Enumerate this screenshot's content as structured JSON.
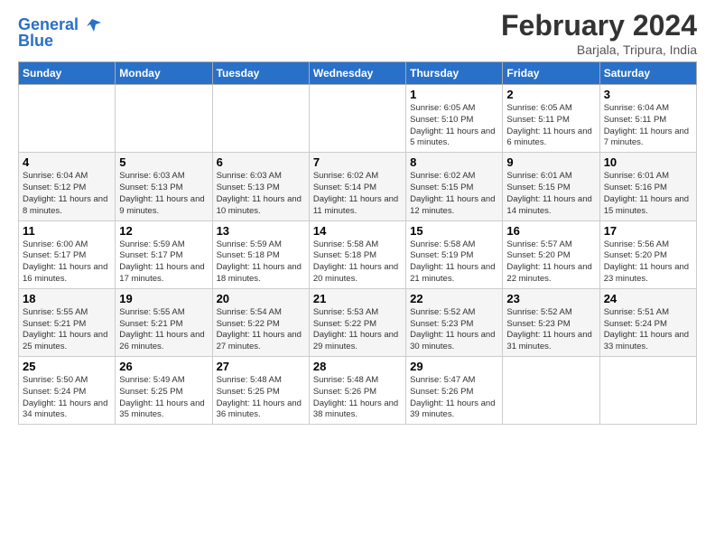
{
  "header": {
    "logo_line1": "General",
    "logo_line2": "Blue",
    "month_year": "February 2024",
    "location": "Barjala, Tripura, India"
  },
  "weekdays": [
    "Sunday",
    "Monday",
    "Tuesday",
    "Wednesday",
    "Thursday",
    "Friday",
    "Saturday"
  ],
  "weeks": [
    [
      {
        "day": "",
        "info": ""
      },
      {
        "day": "",
        "info": ""
      },
      {
        "day": "",
        "info": ""
      },
      {
        "day": "",
        "info": ""
      },
      {
        "day": "1",
        "info": "Sunrise: 6:05 AM\nSunset: 5:10 PM\nDaylight: 11 hours and 5 minutes."
      },
      {
        "day": "2",
        "info": "Sunrise: 6:05 AM\nSunset: 5:11 PM\nDaylight: 11 hours and 6 minutes."
      },
      {
        "day": "3",
        "info": "Sunrise: 6:04 AM\nSunset: 5:11 PM\nDaylight: 11 hours and 7 minutes."
      }
    ],
    [
      {
        "day": "4",
        "info": "Sunrise: 6:04 AM\nSunset: 5:12 PM\nDaylight: 11 hours and 8 minutes."
      },
      {
        "day": "5",
        "info": "Sunrise: 6:03 AM\nSunset: 5:13 PM\nDaylight: 11 hours and 9 minutes."
      },
      {
        "day": "6",
        "info": "Sunrise: 6:03 AM\nSunset: 5:13 PM\nDaylight: 11 hours and 10 minutes."
      },
      {
        "day": "7",
        "info": "Sunrise: 6:02 AM\nSunset: 5:14 PM\nDaylight: 11 hours and 11 minutes."
      },
      {
        "day": "8",
        "info": "Sunrise: 6:02 AM\nSunset: 5:15 PM\nDaylight: 11 hours and 12 minutes."
      },
      {
        "day": "9",
        "info": "Sunrise: 6:01 AM\nSunset: 5:15 PM\nDaylight: 11 hours and 14 minutes."
      },
      {
        "day": "10",
        "info": "Sunrise: 6:01 AM\nSunset: 5:16 PM\nDaylight: 11 hours and 15 minutes."
      }
    ],
    [
      {
        "day": "11",
        "info": "Sunrise: 6:00 AM\nSunset: 5:17 PM\nDaylight: 11 hours and 16 minutes."
      },
      {
        "day": "12",
        "info": "Sunrise: 5:59 AM\nSunset: 5:17 PM\nDaylight: 11 hours and 17 minutes."
      },
      {
        "day": "13",
        "info": "Sunrise: 5:59 AM\nSunset: 5:18 PM\nDaylight: 11 hours and 18 minutes."
      },
      {
        "day": "14",
        "info": "Sunrise: 5:58 AM\nSunset: 5:18 PM\nDaylight: 11 hours and 20 minutes."
      },
      {
        "day": "15",
        "info": "Sunrise: 5:58 AM\nSunset: 5:19 PM\nDaylight: 11 hours and 21 minutes."
      },
      {
        "day": "16",
        "info": "Sunrise: 5:57 AM\nSunset: 5:20 PM\nDaylight: 11 hours and 22 minutes."
      },
      {
        "day": "17",
        "info": "Sunrise: 5:56 AM\nSunset: 5:20 PM\nDaylight: 11 hours and 23 minutes."
      }
    ],
    [
      {
        "day": "18",
        "info": "Sunrise: 5:55 AM\nSunset: 5:21 PM\nDaylight: 11 hours and 25 minutes."
      },
      {
        "day": "19",
        "info": "Sunrise: 5:55 AM\nSunset: 5:21 PM\nDaylight: 11 hours and 26 minutes."
      },
      {
        "day": "20",
        "info": "Sunrise: 5:54 AM\nSunset: 5:22 PM\nDaylight: 11 hours and 27 minutes."
      },
      {
        "day": "21",
        "info": "Sunrise: 5:53 AM\nSunset: 5:22 PM\nDaylight: 11 hours and 29 minutes."
      },
      {
        "day": "22",
        "info": "Sunrise: 5:52 AM\nSunset: 5:23 PM\nDaylight: 11 hours and 30 minutes."
      },
      {
        "day": "23",
        "info": "Sunrise: 5:52 AM\nSunset: 5:23 PM\nDaylight: 11 hours and 31 minutes."
      },
      {
        "day": "24",
        "info": "Sunrise: 5:51 AM\nSunset: 5:24 PM\nDaylight: 11 hours and 33 minutes."
      }
    ],
    [
      {
        "day": "25",
        "info": "Sunrise: 5:50 AM\nSunset: 5:24 PM\nDaylight: 11 hours and 34 minutes."
      },
      {
        "day": "26",
        "info": "Sunrise: 5:49 AM\nSunset: 5:25 PM\nDaylight: 11 hours and 35 minutes."
      },
      {
        "day": "27",
        "info": "Sunrise: 5:48 AM\nSunset: 5:25 PM\nDaylight: 11 hours and 36 minutes."
      },
      {
        "day": "28",
        "info": "Sunrise: 5:48 AM\nSunset: 5:26 PM\nDaylight: 11 hours and 38 minutes."
      },
      {
        "day": "29",
        "info": "Sunrise: 5:47 AM\nSunset: 5:26 PM\nDaylight: 11 hours and 39 minutes."
      },
      {
        "day": "",
        "info": ""
      },
      {
        "day": "",
        "info": ""
      }
    ]
  ]
}
